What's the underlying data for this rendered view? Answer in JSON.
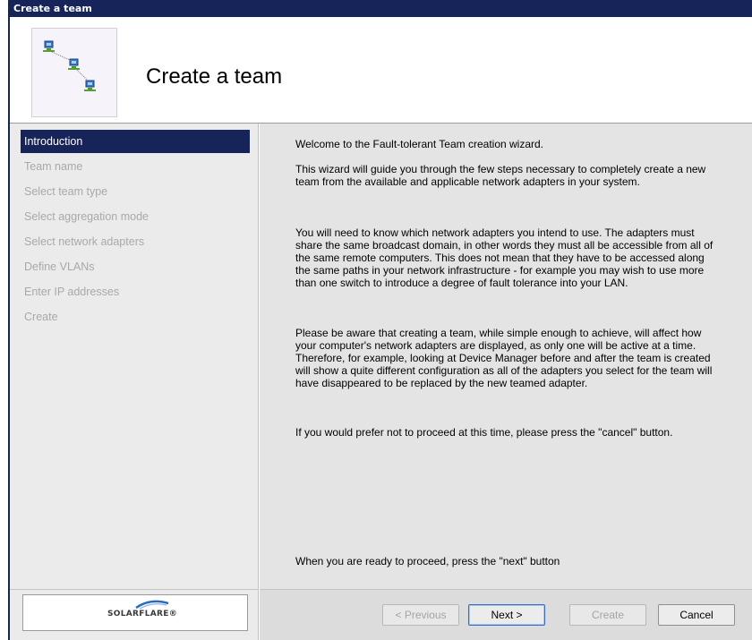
{
  "window": {
    "title": "Create a team"
  },
  "header": {
    "title": "Create a team",
    "icon": "network-computers-icon"
  },
  "nav": {
    "items": [
      {
        "label": "Introduction",
        "selected": true
      },
      {
        "label": "Team name",
        "selected": false
      },
      {
        "label": "Select team type",
        "selected": false
      },
      {
        "label": "Select aggregation mode",
        "selected": false
      },
      {
        "label": "Select network adapters",
        "selected": false
      },
      {
        "label": "Define VLANs",
        "selected": false
      },
      {
        "label": "Enter IP addresses",
        "selected": false
      },
      {
        "label": "Create",
        "selected": false
      }
    ]
  },
  "content": {
    "welcome": "Welcome to the Fault-tolerant Team creation wizard.",
    "para1": "This wizard will guide you through the few steps necessary to completely create a new team from the available and applicable network adapters in your system.",
    "para2": "You will need to know which network adapters you intend to use.  The adapters must share the same broadcast domain, in other words they must all be accessible from all of the same remote computers.  This does not mean that they have to be accessed along the same paths in your network infrastructure - for example you may wish to use more than one switch to introduce a degree of fault tolerance into your LAN.",
    "para3": "Please be aware that creating a team, while simple enough to achieve, will affect how your computer's network adapters are displayed, as only one will be active at a time.  Therefore, for example, looking at Device Manager before and after the team is created will show a quite different configuration as all of the adapters you select for the team will have disappeared to be replaced by the new teamed adapter.",
    "para4": "If you would prefer not to proceed at this time, please press the \"cancel\" button.",
    "footer": "When you are ready to proceed, press the \"next\" button"
  },
  "logo": {
    "text": "SOLARFLARE®"
  },
  "buttons": {
    "previous": "< Previous",
    "next": "Next >",
    "create": "Create",
    "cancel": "Cancel"
  },
  "colors": {
    "titlebar": "#16245a",
    "selected": "#16245a",
    "logo_arc": "#2a6bbd"
  }
}
